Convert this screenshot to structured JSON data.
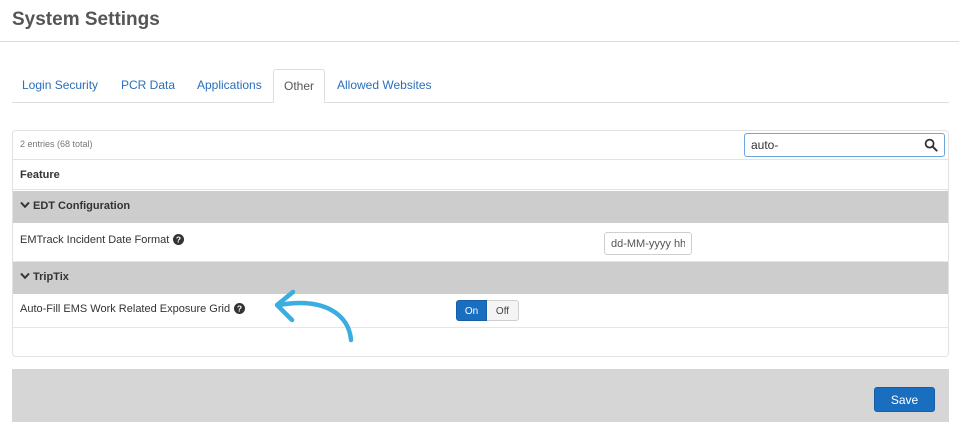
{
  "page": {
    "title": "System Settings"
  },
  "tabs": [
    {
      "label": "Login Security",
      "active": false
    },
    {
      "label": "PCR Data",
      "active": false
    },
    {
      "label": "Applications",
      "active": false
    },
    {
      "label": "Other",
      "active": true
    },
    {
      "label": "Allowed Websites",
      "active": false
    }
  ],
  "table": {
    "entries_text": "2 entries (68 total)",
    "search": {
      "value": "auto-",
      "icon": "search-icon"
    },
    "column_header": "Feature",
    "groups": [
      {
        "label": "EDT Configuration",
        "icon": "chevron-down-icon",
        "items": [
          {
            "label": "EMTrack Incident Date Format",
            "help_icon": "question-circle-icon",
            "control": "text",
            "value": "dd-MM-yyyy hh"
          }
        ]
      },
      {
        "label": "TripTix",
        "icon": "chevron-down-icon",
        "items": [
          {
            "label": "Auto-Fill EMS Work Related Exposure Grid",
            "help_icon": "question-circle-icon",
            "control": "toggle",
            "on_label": "On",
            "off_label": "Off",
            "selected": "On"
          }
        ]
      }
    ]
  },
  "footer": {
    "save_label": "Save"
  },
  "annotation": {
    "icon": "curved-arrow-icon",
    "color": "#3aaee0"
  },
  "colors": {
    "primary": "#1a6ec0",
    "link": "#2a6fbb",
    "group_bg": "#cdcdcd",
    "footer_bg": "#d6d6d6"
  }
}
